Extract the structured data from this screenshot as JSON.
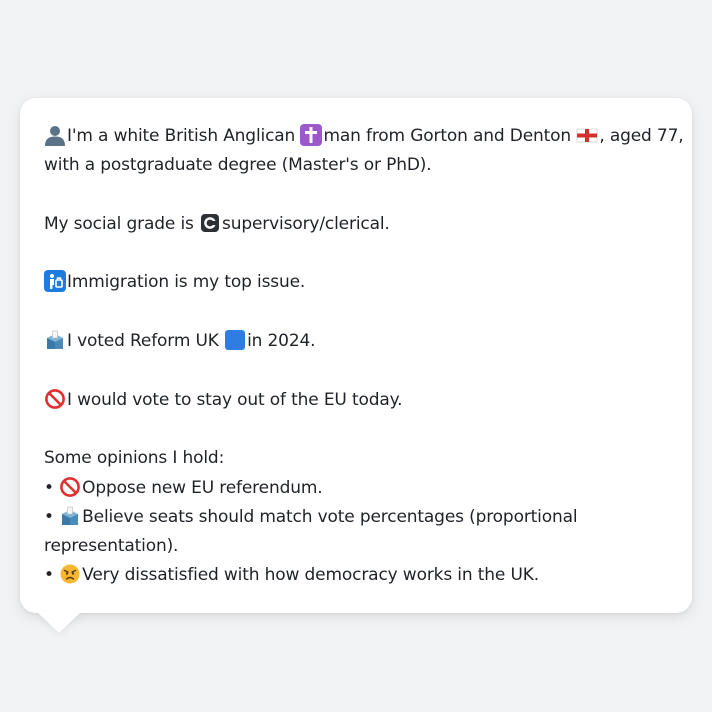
{
  "persona": {
    "intro_line1_a": "I'm a white British Anglican",
    "intro_line1_b": "man from Gorton and Denton",
    "intro_line1_c": ", aged 77,",
    "intro_line2": "with a postgraduate degree (Master's or PhD).",
    "social_grade_a": "My social grade is",
    "social_grade_b": "supervisory/clerical.",
    "top_issue": "Immigration is my top issue.",
    "vote_2024_a": "I voted Reform UK",
    "vote_2024_b": "in 2024.",
    "eu_stance": "I would vote to stay out of the EU today.",
    "opinions_heading": "Some opinions I hold:",
    "bullet_char": "•",
    "opinions": [
      {
        "icon": "no-entry-icon",
        "text": "Oppose new EU referendum."
      },
      {
        "icon": "ballot-box-icon",
        "text_line1": "Believe seats should match vote percentages (proportional",
        "text_line2": "representation)."
      },
      {
        "icon": "angry-face-icon",
        "text": "Very dissatisfied with how democracy works in the UK."
      }
    ]
  },
  "icons": {
    "person": "person-silhouette-icon",
    "religion": "latin-cross-icon",
    "flag": "england-flag-icon",
    "grade": "letter-c-icon",
    "issue": "passport-control-icon",
    "vote": "ballot-box-icon",
    "party": "blue-square-icon",
    "eu": "no-entry-icon"
  },
  "colors": {
    "page_background": "#f2f3f5",
    "card_background": "#ffffff",
    "text": "#1f2328",
    "reform_blue": "#2f7de1"
  }
}
